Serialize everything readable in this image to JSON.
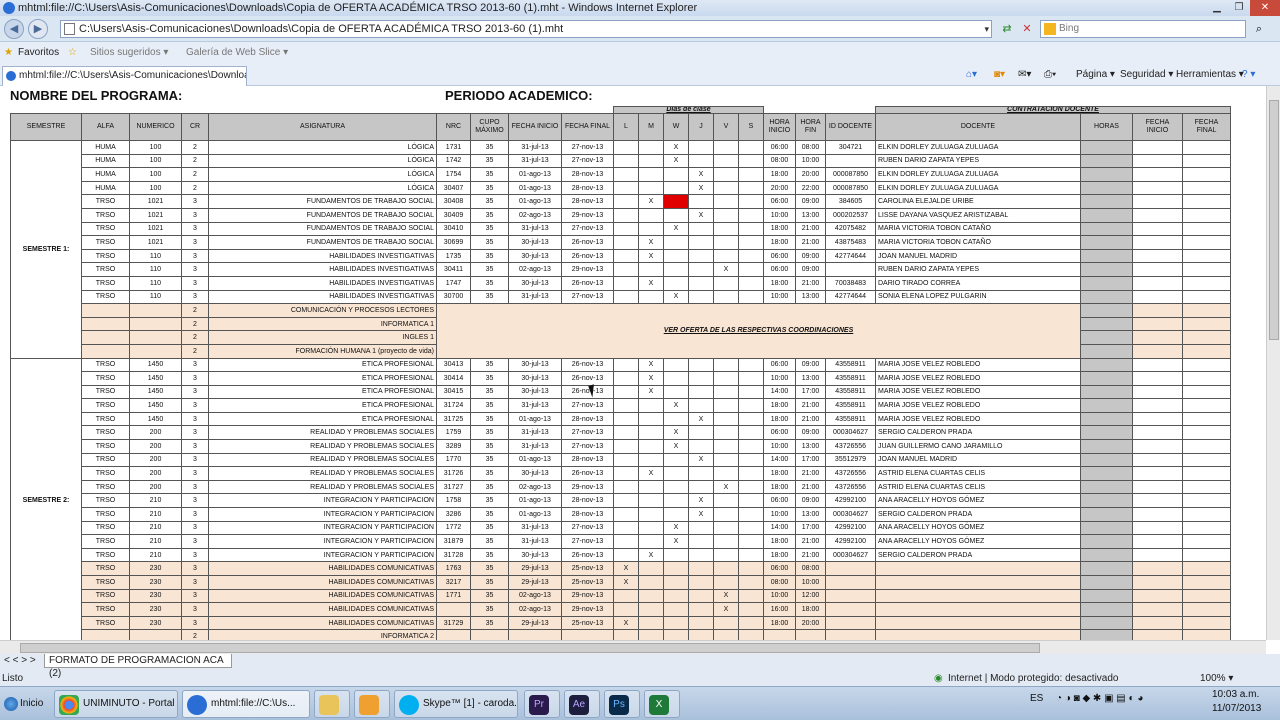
{
  "window": {
    "title": "mhtml:file://C:\\Users\\Asis-Comunicaciones\\Downloads\\Copia de OFERTA ACADÉMICA TRSO 2013-60 (1).mht - Windows Internet Explorer",
    "url": "C:\\Users\\Asis-Comunicaciones\\Downloads\\Copia de OFERTA ACADÉMICA TRSO 2013-60 (1).mht",
    "search_placeholder": "Bing",
    "favorites_label": "Favoritos",
    "suggested_sites": "Sitios sugeridos ▾",
    "web_slice": "Galería de Web Slice ▾",
    "tab_title": "mhtml:file://C:\\Users\\Asis-Comunicaciones\\Downloads\\...",
    "cmd_page": "Página ▾",
    "cmd_security": "Seguridad ▾",
    "cmd_tools": "Herramientas ▾",
    "cmd_help": "? ▾"
  },
  "sheet": {
    "program_label": "NOMBRE DEL PROGRAMA:",
    "period_label": "PERIODO ACADEMICO:",
    "days_group": "Días de clase",
    "contract_group": "CONTRATACION DOCENTE",
    "headers": {
      "semestre": "SEMESTRE",
      "alfa": "ALFA",
      "numerico": "NUMERICO",
      "cr": "CR",
      "asignatura": "ASIGNATURA",
      "nrc": "NRC",
      "cupo": "CUPO MÁXIMO",
      "fecha_inicio": "FECHA INICIO",
      "fecha_final": "FECHA FINAL",
      "d_l": "L",
      "d_m": "M",
      "d_w": "W",
      "d_j": "J",
      "d_v": "V",
      "d_s": "S",
      "hora_inicio": "HORA INICIO",
      "hora_fin": "HORA FIN",
      "id_docente": "ID DOCENTE",
      "docente": "DOCENTE",
      "horas": "HORAS",
      "fecha_inicio2": "FECHA INICIO",
      "fecha_final2": "FECHA FINAL"
    },
    "semester1_label": "SEMESTRE 1:",
    "semester2_label": "SEMESTRE 2:",
    "note": "VER OFERTA DE LAS RESPECTIVAS COORDINACIONES",
    "rows_s1": [
      [
        "HUMA",
        "100",
        "2",
        "LÓGICA",
        "1731",
        "35",
        "31-jul-13",
        "27-nov-13",
        "",
        "",
        "X",
        "",
        "",
        "",
        "06:00",
        "08:00",
        "304721",
        "ELKIN DORLEY ZULUAGA ZULUAGA"
      ],
      [
        "HUMA",
        "100",
        "2",
        "LÓGICA",
        "1742",
        "35",
        "31-jul-13",
        "27-nov-13",
        "",
        "",
        "X",
        "",
        "",
        "",
        "08:00",
        "10:00",
        "",
        "RUBEN DARIO ZAPATA YEPES"
      ],
      [
        "HUMA",
        "100",
        "2",
        "LÓGICA",
        "1754",
        "35",
        "01-ago-13",
        "28-nov-13",
        "",
        "",
        "",
        "X",
        "",
        "",
        "18:00",
        "20:00",
        "000087850",
        "ELKIN DORLEY ZULUAGA ZULUAGA"
      ],
      [
        "HUMA",
        "100",
        "2",
        "LÓGICA",
        "30407",
        "35",
        "01-ago-13",
        "28-nov-13",
        "",
        "",
        "",
        "X",
        "",
        "",
        "20:00",
        "22:00",
        "000087850",
        "ELKIN DORLEY ZULUAGA ZULUAGA"
      ],
      [
        "TRSO",
        "1021",
        "3",
        "FUNDAMENTOS DE TRABAJO SOCIAL",
        "30408",
        "35",
        "01-ago-13",
        "28-nov-13",
        "",
        "X",
        "",
        "",
        "",
        "",
        "06:00",
        "09:00",
        "384605",
        "CAROLINA ELEJALDE URIBE"
      ],
      [
        "TRSO",
        "1021",
        "3",
        "FUNDAMENTOS DE TRABAJO SOCIAL",
        "30409",
        "35",
        "02-ago-13",
        "29-nov-13",
        "",
        "",
        "",
        "X",
        "",
        "",
        "10:00",
        "13:00",
        "000202537",
        "LISSE DAYANA VASQUEZ ARISTIZABAL"
      ],
      [
        "TRSO",
        "1021",
        "3",
        "FUNDAMENTOS DE TRABAJO SOCIAL",
        "30410",
        "35",
        "31-jul-13",
        "27-nov-13",
        "",
        "",
        "X",
        "",
        "",
        "",
        "18:00",
        "21:00",
        "42075482",
        "MARIA VICTORIA TOBON CATAÑO"
      ],
      [
        "TRSO",
        "1021",
        "3",
        "FUNDAMENTOS DE TRABAJO SOCIAL",
        "30699",
        "35",
        "30-jul-13",
        "26-nov-13",
        "",
        "X",
        "",
        "",
        "",
        "",
        "18:00",
        "21:00",
        "43875483",
        "MARIA VICTORIA TOBON CATAÑO"
      ],
      [
        "TRSO",
        "110",
        "3",
        "HABILIDADES INVESTIGATIVAS",
        "1735",
        "35",
        "30-jul-13",
        "26-nov-13",
        "",
        "X",
        "",
        "",
        "",
        "",
        "06:00",
        "09:00",
        "42774644",
        "JOAN MANUEL MADRID"
      ],
      [
        "TRSO",
        "110",
        "3",
        "HABILIDADES INVESTIGATIVAS",
        "30411",
        "35",
        "02-ago-13",
        "29-nov-13",
        "",
        "",
        "",
        "",
        "X",
        "",
        "06:00",
        "09:00",
        "",
        "RUBEN DARIO ZAPATA YEPES"
      ],
      [
        "TRSO",
        "110",
        "3",
        "HABILIDADES INVESTIGATIVAS",
        "1747",
        "35",
        "30-jul-13",
        "26-nov-13",
        "",
        "X",
        "",
        "",
        "",
        "",
        "18:00",
        "21:00",
        "70038483",
        "DARIO TIRADO CORREA"
      ],
      [
        "TRSO",
        "110",
        "3",
        "HABILIDADES INVESTIGATIVAS",
        "30700",
        "35",
        "31-jul-13",
        "27-nov-13",
        "",
        "",
        "X",
        "",
        "",
        "",
        "10:00",
        "13:00",
        "42774644",
        "SONIA ELENA LOPEZ PULGARIN"
      ]
    ],
    "general_s1": [
      [
        "2",
        "COMUNICACIÓN Y PROCESOS LECTORES"
      ],
      [
        "2",
        "INFORMATICA 1"
      ],
      [
        "2",
        "INGLES 1"
      ],
      [
        "2",
        "FORMACIÓN HUMANA 1 (proyecto de vida)"
      ]
    ],
    "rows_s2": [
      [
        "TRSO",
        "1450",
        "3",
        "ETICA PROFESIONAL",
        "30413",
        "35",
        "30-jul-13",
        "26-nov-13",
        "",
        "X",
        "",
        "",
        "",
        "",
        "06:00",
        "09:00",
        "43558911",
        "MARIA JOSE VELEZ ROBLEDO"
      ],
      [
        "TRSO",
        "1450",
        "3",
        "ETICA PROFESIONAL",
        "30414",
        "35",
        "30-jul-13",
        "26-nov-13",
        "",
        "X",
        "",
        "",
        "",
        "",
        "10:00",
        "13:00",
        "43558911",
        "MARIA JOSE VELEZ ROBLEDO"
      ],
      [
        "TRSO",
        "1450",
        "3",
        "ETICA PROFESIONAL",
        "30415",
        "35",
        "30-jul-13",
        "26-nov-13",
        "",
        "X",
        "",
        "",
        "",
        "",
        "14:00",
        "17:00",
        "43558911",
        "MARIA JOSE VELEZ ROBLEDO"
      ],
      [
        "TRSO",
        "1450",
        "3",
        "ETICA PROFESIONAL",
        "31724",
        "35",
        "31-jul-13",
        "27-nov-13",
        "",
        "",
        "X",
        "",
        "",
        "",
        "18:00",
        "21:00",
        "43558911",
        "MARIA JOSE VELEZ ROBLEDO"
      ],
      [
        "TRSO",
        "1450",
        "3",
        "ETICA PROFESIONAL",
        "31725",
        "35",
        "01-ago-13",
        "28-nov-13",
        "",
        "",
        "",
        "X",
        "",
        "",
        "18:00",
        "21:00",
        "43558911",
        "MARIA JOSE VELEZ ROBLEDO"
      ],
      [
        "TRSO",
        "200",
        "3",
        "REALIDAD Y PROBLEMAS SOCIALES",
        "1759",
        "35",
        "31-jul-13",
        "27-nov-13",
        "",
        "",
        "X",
        "",
        "",
        "",
        "06:00",
        "09:00",
        "000304627",
        "SERGIO CALDERON PRADA"
      ],
      [
        "TRSO",
        "200",
        "3",
        "REALIDAD Y PROBLEMAS SOCIALES",
        "3289",
        "35",
        "31-jul-13",
        "27-nov-13",
        "",
        "",
        "X",
        "",
        "",
        "",
        "10:00",
        "13:00",
        "43726556",
        "JUAN GUILLERMO CANO JARAMILLO"
      ],
      [
        "TRSO",
        "200",
        "3",
        "REALIDAD Y PROBLEMAS SOCIALES",
        "1770",
        "35",
        "01-ago-13",
        "28-nov-13",
        "",
        "",
        "",
        "X",
        "",
        "",
        "14:00",
        "17:00",
        "35512979",
        "JOAN MANUEL MADRID"
      ],
      [
        "TRSO",
        "200",
        "3",
        "REALIDAD Y PROBLEMAS SOCIALES",
        "31726",
        "35",
        "30-jul-13",
        "26-nov-13",
        "",
        "X",
        "",
        "",
        "",
        "",
        "18:00",
        "21:00",
        "43726556",
        "ASTRID ELENA CUARTAS CELIS"
      ],
      [
        "TRSO",
        "200",
        "3",
        "REALIDAD Y PROBLEMAS SOCIALES",
        "31727",
        "35",
        "02-ago-13",
        "29-nov-13",
        "",
        "",
        "",
        "",
        "X",
        "",
        "18:00",
        "21:00",
        "43726556",
        "ASTRID ELENA CUARTAS CELIS"
      ],
      [
        "TRSO",
        "210",
        "3",
        "INTEGRACION Y PARTICIPACION",
        "1758",
        "35",
        "01-ago-13",
        "28-nov-13",
        "",
        "",
        "",
        "X",
        "",
        "",
        "06:00",
        "09:00",
        "42992100",
        "ANA ARACELLY HOYOS GÓMEZ"
      ],
      [
        "TRSO",
        "210",
        "3",
        "INTEGRACION Y PARTICIPACION",
        "3286",
        "35",
        "01-ago-13",
        "28-nov-13",
        "",
        "",
        "",
        "X",
        "",
        "",
        "10:00",
        "13:00",
        "000304627",
        "SERGIO CALDERON PRADA"
      ],
      [
        "TRSO",
        "210",
        "3",
        "INTEGRACION Y PARTICIPACION",
        "1772",
        "35",
        "31-jul-13",
        "27-nov-13",
        "",
        "",
        "X",
        "",
        "",
        "",
        "14:00",
        "17:00",
        "42992100",
        "ANA ARACELLY HOYOS GÓMEZ"
      ],
      [
        "TRSO",
        "210",
        "3",
        "INTEGRACION Y PARTICIPACION",
        "31879",
        "35",
        "31-jul-13",
        "27-nov-13",
        "",
        "",
        "X",
        "",
        "",
        "",
        "18:00",
        "21:00",
        "42992100",
        "ANA ARACELLY HOYOS GÓMEZ"
      ],
      [
        "TRSO",
        "210",
        "3",
        "INTEGRACION Y PARTICIPACION",
        "31728",
        "35",
        "30-jul-13",
        "26-nov-13",
        "",
        "X",
        "",
        "",
        "",
        "",
        "18:00",
        "21:00",
        "000304627",
        "SERGIO CALDERON PRADA"
      ]
    ],
    "rows_s2_tan": [
      [
        "TRSO",
        "230",
        "3",
        "HABILIDADES COMUNICATIVAS",
        "1763",
        "35",
        "29-jul-13",
        "25-nov-13",
        "X",
        "",
        "",
        "",
        "",
        "",
        "06:00",
        "08:00",
        "",
        ""
      ],
      [
        "TRSO",
        "230",
        "3",
        "HABILIDADES COMUNICATIVAS",
        "3217",
        "35",
        "29-jul-13",
        "25-nov-13",
        "X",
        "",
        "",
        "",
        "",
        "",
        "08:00",
        "10:00",
        "",
        ""
      ],
      [
        "TRSO",
        "230",
        "3",
        "HABILIDADES COMUNICATIVAS",
        "1771",
        "35",
        "02-ago-13",
        "29-nov-13",
        "",
        "",
        "",
        "",
        "X",
        "",
        "10:00",
        "12:00",
        "",
        ""
      ],
      [
        "TRSO",
        "230",
        "3",
        "HABILIDADES COMUNICATIVAS",
        "",
        "35",
        "02-ago-13",
        "29-nov-13",
        "",
        "",
        "",
        "",
        "X",
        "",
        "16:00",
        "18:00",
        "",
        ""
      ],
      [
        "TRSO",
        "230",
        "3",
        "HABILIDADES COMUNICATIVAS",
        "31729",
        "35",
        "29-jul-13",
        "25-nov-13",
        "X",
        "",
        "",
        "",
        "",
        "",
        "18:00",
        "20:00",
        "",
        ""
      ]
    ],
    "last_row": [
      "2",
      "INFORMATICA 2"
    ]
  },
  "status": {
    "sheet_tab": "FORMATO DE PROGRAMACION ACA (2)",
    "nav_arrows": "< < > >",
    "ready": "Listo",
    "zone": "Internet | Modo protegido: desactivado",
    "zoom": "100% ▾"
  },
  "taskbar": {
    "start": "Inicio",
    "chrome": "UNIMINUTO - Portal ...",
    "ie": "mhtml:file://C:\\Us...",
    "skype": "Skype™ [1] - caroda...",
    "lang": "ES",
    "time": "10:03 a.m.",
    "date": "11/07/2013"
  },
  "colors": {
    "tan": "#f9e5d3",
    "gray": "#c6c6c6",
    "red_cell": "#e00000"
  }
}
